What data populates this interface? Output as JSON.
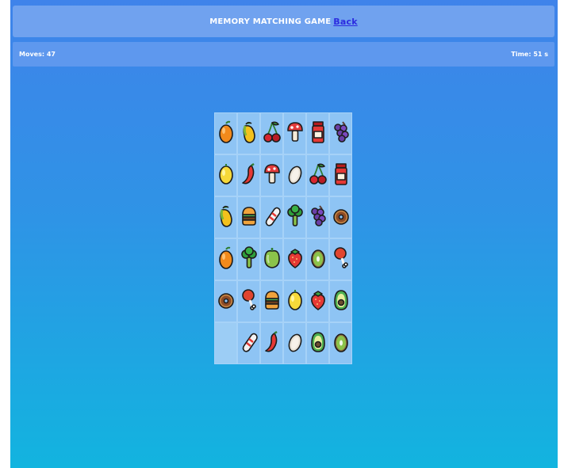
{
  "header": {
    "title": "MEMORY MATCHING GAME",
    "back_link": "Back"
  },
  "stats": {
    "moves": "Moves: 47",
    "time": "Time: 51 s"
  },
  "board": {
    "rows": 6,
    "cols": 6,
    "cards": [
      "orange-icon",
      "mango-icon",
      "cherry-icon",
      "mushroom-icon",
      "jam-jar-icon",
      "grapes-icon",
      "lemon-icon",
      "chili-icon",
      "mushroom-icon",
      "coconut-icon",
      "cherry-icon",
      "jam-jar-icon",
      "mango-icon",
      "burger-icon",
      "sausage-icon",
      "broccoli-icon",
      "grapes-icon",
      "donut-icon",
      "orange-icon",
      "broccoli-icon",
      "pepper-icon",
      "strawberry-icon",
      "kiwi-icon",
      "drumstick-icon",
      "donut-icon",
      "drumstick-icon",
      "burger-icon",
      "lemon-icon",
      "strawberry-icon",
      "avocado-icon",
      "empty",
      "sausage-icon",
      "chili-icon",
      "coconut-icon",
      "avocado-icon",
      "kiwi-icon"
    ]
  }
}
